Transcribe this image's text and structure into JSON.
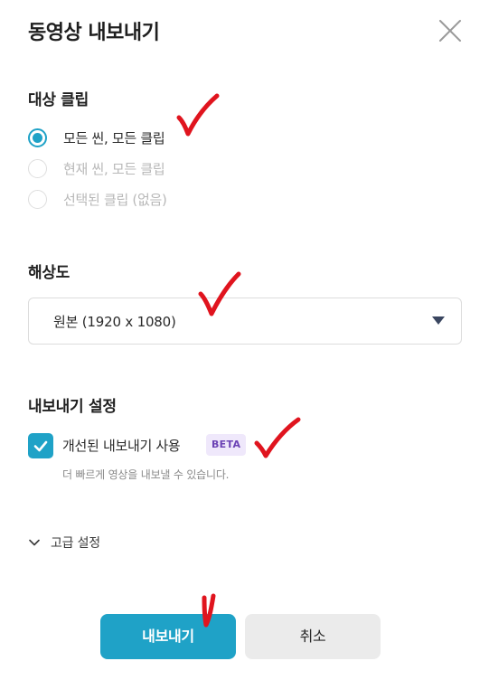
{
  "dialog": {
    "title": "동영상 내보내기",
    "close_icon": "close-icon"
  },
  "clip_section": {
    "label": "대상 클립",
    "options": [
      {
        "label": "모든 씬, 모든 클립",
        "selected": true,
        "disabled": false
      },
      {
        "label": "현재 씬, 모든 클립",
        "selected": false,
        "disabled": true
      },
      {
        "label": "선택된 클립 (없음)",
        "selected": false,
        "disabled": true
      }
    ]
  },
  "resolution_section": {
    "label": "해상도",
    "selected_value": "원본 (1920 x 1080)"
  },
  "export_settings": {
    "label": "내보내기 설정",
    "improved_export": {
      "label": "개선된 내보내기 사용",
      "checked": true,
      "badge": "BETA",
      "helper": "더 빠르게 영상을 내보낼 수 있습니다."
    }
  },
  "advanced": {
    "label": "고급 설정",
    "icon": "chevron-down-icon"
  },
  "actions": {
    "export_label": "내보내기",
    "cancel_label": "취소"
  },
  "colors": {
    "accent": "#1fa2c7",
    "badge_bg": "#efe8fb",
    "badge_text": "#6c43b5",
    "annotation": "#e0141e"
  }
}
